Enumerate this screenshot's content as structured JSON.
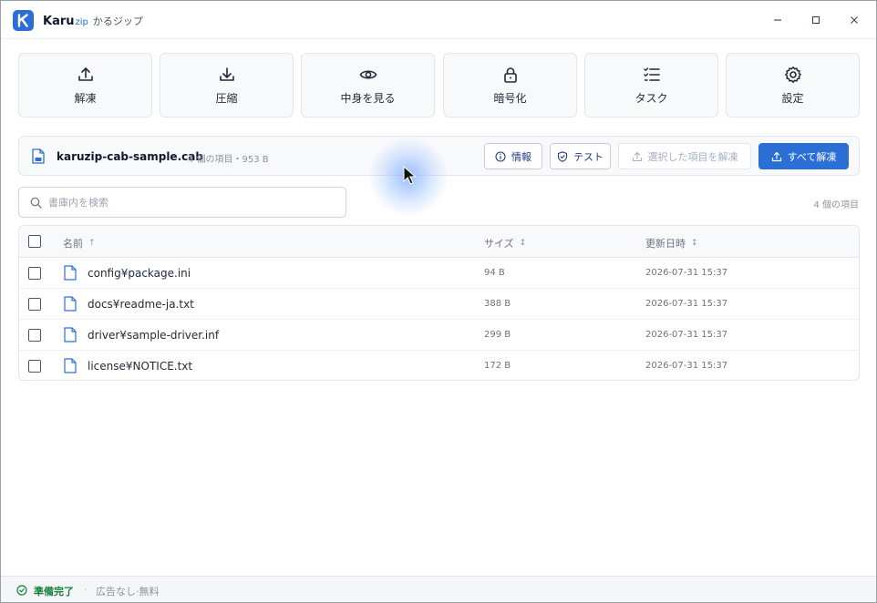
{
  "app": {
    "name": "Karu",
    "name_suffix": "zip",
    "name_jp": "かるジップ",
    "logo_letter": "K",
    "accent_color": "#2b6fd6"
  },
  "window_controls": {
    "minimize": "minimize-icon",
    "maximize": "maximize-icon",
    "close": "close-icon"
  },
  "toolbar": [
    {
      "label": "解凍",
      "icon": "upload-icon"
    },
    {
      "label": "圧縮",
      "icon": "download-icon"
    },
    {
      "label": "中身を見る",
      "icon": "eye-icon"
    },
    {
      "label": "暗号化",
      "icon": "lock-icon"
    },
    {
      "label": "タスク",
      "icon": "list-check-icon"
    },
    {
      "label": "設定",
      "icon": "gear-icon"
    }
  ],
  "archive": {
    "name": "karuzip-cab-sample.cab",
    "meta": "4 個の項目・953 B",
    "buttons": {
      "info": "情報",
      "test": "テスト",
      "extract_selected": "選択した項目を解凍",
      "extract_all": "すべて解凍"
    }
  },
  "search": {
    "placeholder": "書庫内を検索",
    "value": ""
  },
  "item_count": "4 個の項目",
  "table": {
    "columns": {
      "name": "名前",
      "name_sort": "↑",
      "size": "サイズ",
      "size_sort": "↕",
      "modified": "更新日時",
      "modified_sort": "↕"
    },
    "rows": [
      {
        "name": "config¥package.ini",
        "size": "94 B",
        "modified": "2026-07-31 15:37"
      },
      {
        "name": "docs¥readme-ja.txt",
        "size": "388 B",
        "modified": "2026-07-31 15:37"
      },
      {
        "name": "driver¥sample-driver.inf",
        "size": "299 B",
        "modified": "2026-07-31 15:37"
      },
      {
        "name": "license¥NOTICE.txt",
        "size": "172 B",
        "modified": "2026-07-31 15:37"
      }
    ]
  },
  "status": {
    "text": "準備完了",
    "separator": "·",
    "sub": "広告なし·無料",
    "color": "#15803d"
  }
}
